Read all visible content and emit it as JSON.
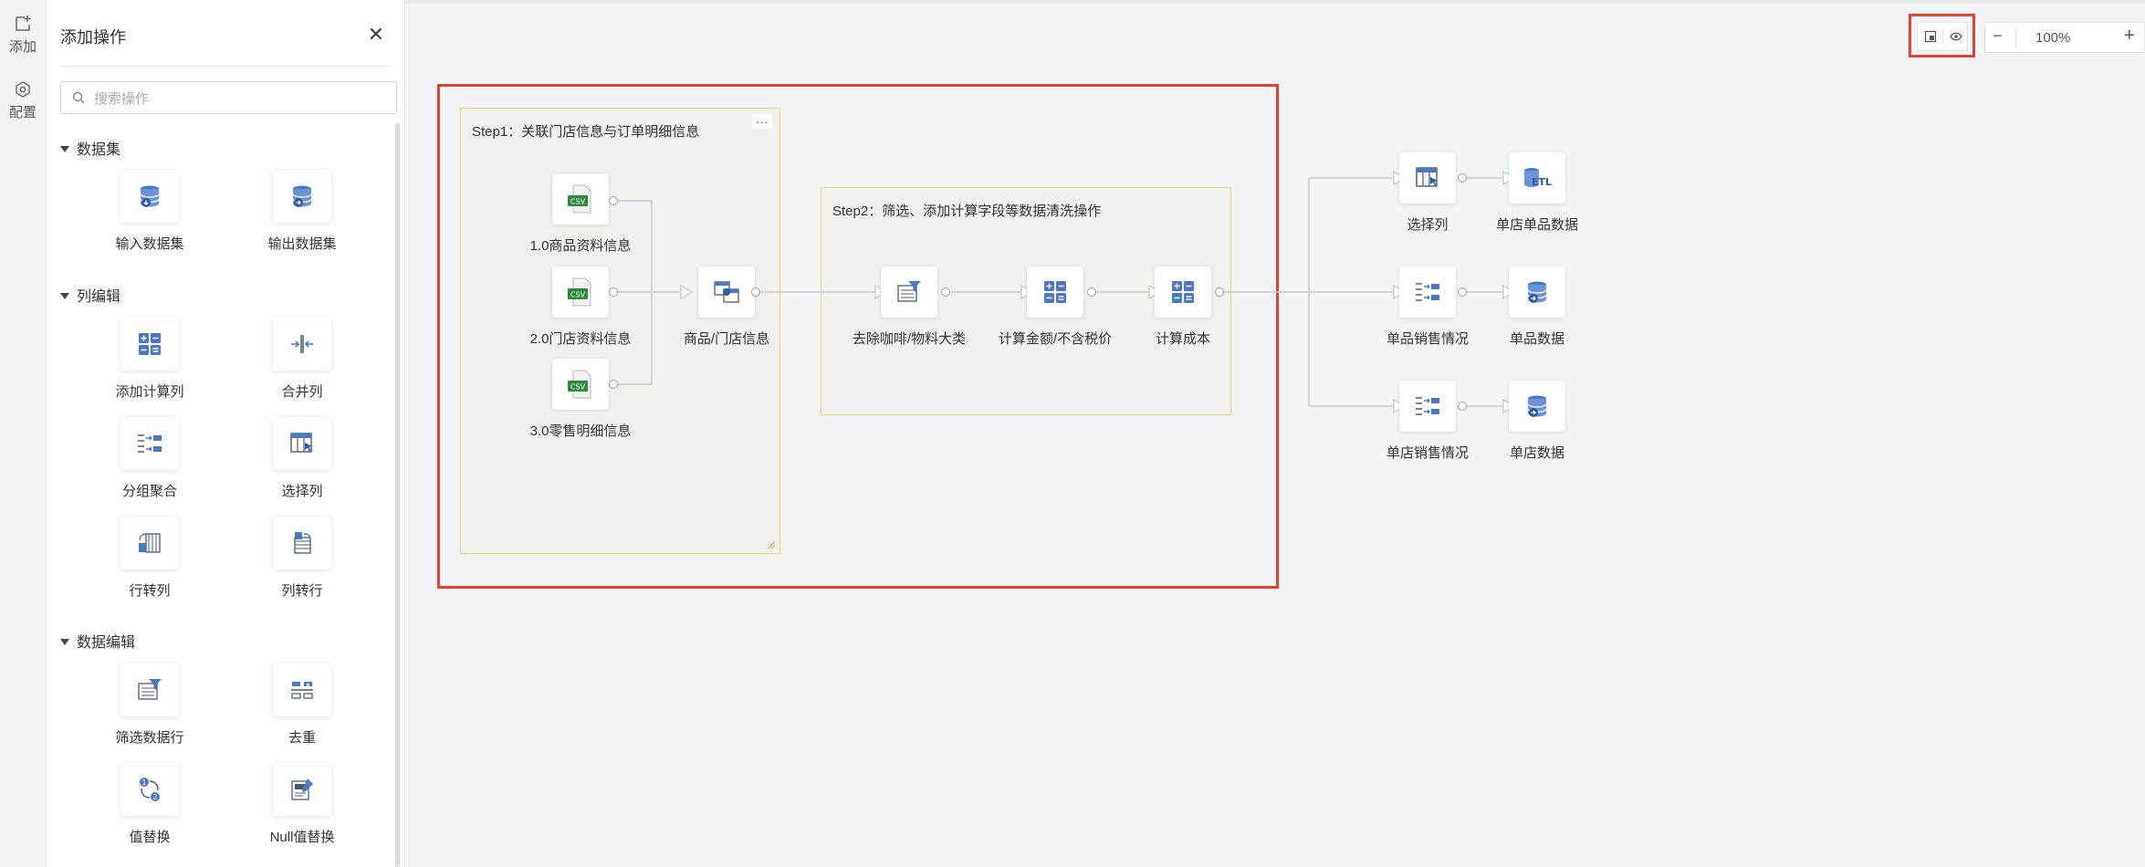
{
  "rail": {
    "add_label": "添加",
    "config_label": "配置"
  },
  "panel": {
    "title": "添加操作",
    "close_icon": "close-icon",
    "search_placeholder": "搜索操作",
    "sections": [
      {
        "title": "数据集",
        "items": [
          {
            "label": "输入数据集",
            "icon": "input-dataset-icon"
          },
          {
            "label": "输出数据集",
            "icon": "output-dataset-icon"
          }
        ]
      },
      {
        "title": "列编辑",
        "items": [
          {
            "label": "添加计算列",
            "icon": "calc-column-icon"
          },
          {
            "label": "合并列",
            "icon": "merge-column-icon"
          },
          {
            "label": "分组聚合",
            "icon": "group-aggregate-icon"
          },
          {
            "label": "选择列",
            "icon": "select-column-icon"
          },
          {
            "label": "行转列",
            "icon": "row-to-column-icon"
          },
          {
            "label": "列转行",
            "icon": "column-to-row-icon"
          }
        ]
      },
      {
        "title": "数据编辑",
        "items": [
          {
            "label": "筛选数据行",
            "icon": "filter-rows-icon"
          },
          {
            "label": "去重",
            "icon": "dedupe-icon"
          },
          {
            "label": "值替换",
            "icon": "value-replace-icon"
          },
          {
            "label": "Null值替换",
            "icon": "null-replace-icon"
          }
        ]
      }
    ]
  },
  "toolbar": {
    "zoom_value": "100%",
    "zoom_minus": "−",
    "zoom_plus": "+"
  },
  "canvas": {
    "step1_title": "Step1：关联门店信息与订单明细信息",
    "step1_menu": "···",
    "step2_title": "Step2：筛选、添加计算字段等数据清洗操作",
    "csv_tag": "CSV",
    "etl_tag": "ETL",
    "nodes": {
      "src1": "1.0商品资料信息",
      "src2": "2.0门店资料信息",
      "src3": "3.0零售明细信息",
      "join": "商品/门店信息",
      "filter": "去除咖啡/物料大类",
      "calc1": "计算金额/不含税价",
      "calc2": "计算成本",
      "select": "选择列",
      "out1": "单店单品数据",
      "agg1": "单品销售情况",
      "out2": "单品数据",
      "agg2": "单店销售情况",
      "out3": "单店数据"
    }
  },
  "colors": {
    "highlight": "#e0442e",
    "group_border": "#f0d66a",
    "group_fill": "#f1f1ed",
    "icon_blue": "#4a78c4",
    "csv_green": "#2e8b3d"
  }
}
